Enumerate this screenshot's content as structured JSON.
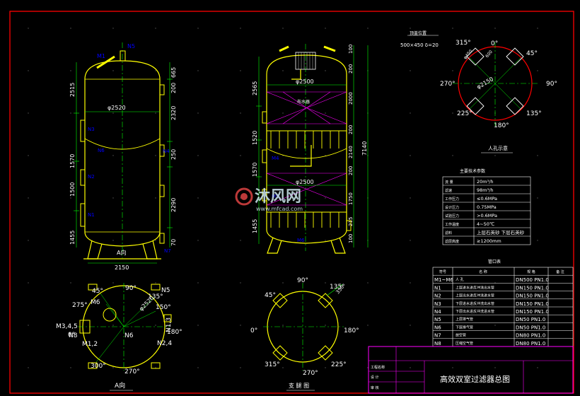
{
  "colors": {
    "background": "#000000",
    "frame": "#ff0000",
    "vessel": "#ffff00",
    "dims": "#00ff00",
    "nozzles": "#0000ff",
    "labels": "#ffffff",
    "distributor": "#ff00ff",
    "watermark": "#cfe9f0"
  },
  "left_vessel": {
    "label_m1": "M1",
    "label_n5": "N5",
    "dims_left": [
      "2515",
      "1570",
      "1500",
      "1455"
    ],
    "dims_right": [
      "665",
      "2320",
      "250",
      "2290",
      "70"
    ],
    "dims_right_small": [
      "200"
    ],
    "diameter": "φ2520",
    "base_width": "2150",
    "nozzles_left": [
      "N3",
      "N2",
      "N1"
    ],
    "nozzles_right": [
      "N6",
      "N4",
      "N7"
    ],
    "view_mark": "A向"
  },
  "middle_vessel": {
    "dims_left": [
      "2565",
      "1520",
      "1570",
      "1455"
    ],
    "dims_right": [
      "100",
      "200",
      "2000",
      "200",
      "2140",
      "200",
      "1750",
      "100",
      "215"
    ],
    "total_height": "7140",
    "diameter_top": "φ2500",
    "diameter_bottom": "φ2500",
    "mid_label": "布水器",
    "nozzle_labels": [
      "M4",
      "M5",
      "M6"
    ]
  },
  "a_view": {
    "title": "A向",
    "angles": [
      "90°",
      "0°",
      "180°",
      "270°",
      "135°",
      "150°",
      "275°",
      "300°",
      "45°"
    ],
    "labels": [
      "N5",
      "M6",
      "M3,4,5",
      "N8",
      "N6",
      "N1,3",
      "N2,4",
      "M1,2"
    ],
    "diameter": "φ2520"
  },
  "support_view": {
    "title": "支 腿 图",
    "angles": [
      "90°",
      "0°",
      "180°",
      "270°",
      "45°",
      "315°",
      "225°",
      "135°"
    ],
    "dim": "350"
  },
  "manhole_view": {
    "title": "人孔示意",
    "spec": "500×450 δ=20",
    "note": "顶盖位置",
    "angles": [
      "0°",
      "45°",
      "90°",
      "135°",
      "180°",
      "225°",
      "270°",
      "315°"
    ],
    "diameter": "φ2150",
    "sub_labels": [
      "φ450",
      "600"
    ]
  },
  "tech_table": {
    "title": "主要技术参数",
    "rows": [
      {
        "name": "流 量",
        "value": "20m³/h"
      },
      {
        "name": "滤速",
        "value": "98m³/h"
      },
      {
        "name": "工作压力",
        "value": "≤0.6MPa"
      },
      {
        "name": "设计压力",
        "value": "0.75MPa"
      },
      {
        "name": "试验压力",
        "value": ">0.6MPa"
      },
      {
        "name": "工作温度",
        "value": "4~50℃"
      },
      {
        "name": "滤料",
        "value": "上层石英砂 下层石英砂"
      },
      {
        "name": "滤层高度",
        "value": "≥1200mm"
      }
    ]
  },
  "nozzle_table": {
    "title": "管口表",
    "headers": [
      "符号",
      "名 称",
      "规 格",
      "备 注"
    ],
    "rows": [
      {
        "sym": "M1~M6",
        "name": "人 孔",
        "spec": "DN500 PN1.0"
      },
      {
        "sym": "N1",
        "name": "上层进水进反冲洗出水管",
        "spec": "DN150 PN1.0"
      },
      {
        "sym": "N2",
        "name": "上层出水进反冲洗进水管",
        "spec": "DN150 PN1.0"
      },
      {
        "sym": "N3",
        "name": "下层进水进反冲洗出水管",
        "spec": "DN150 PN1.0"
      },
      {
        "sym": "N4",
        "name": "下层出水进反冲洗进水管",
        "spec": "DN150 PN1.0"
      },
      {
        "sym": "N5",
        "name": "上层排气管",
        "spec": "DN50 PN1.0"
      },
      {
        "sym": "N6",
        "name": "下层排气管",
        "spec": "DN50 PN1.0"
      },
      {
        "sym": "N7",
        "name": "放空管",
        "spec": "DN80 PN1.0"
      },
      {
        "sym": "N8",
        "name": "压缩空气管",
        "spec": "DN80 PN1.0"
      }
    ]
  },
  "title_block": {
    "title": "高效双室过滤器总图",
    "left_label": "工程名称",
    "left_label2": "设 计",
    "left_label3": "审 核"
  },
  "watermark": {
    "text": "沐风网",
    "url": "www.mfcad.com"
  }
}
